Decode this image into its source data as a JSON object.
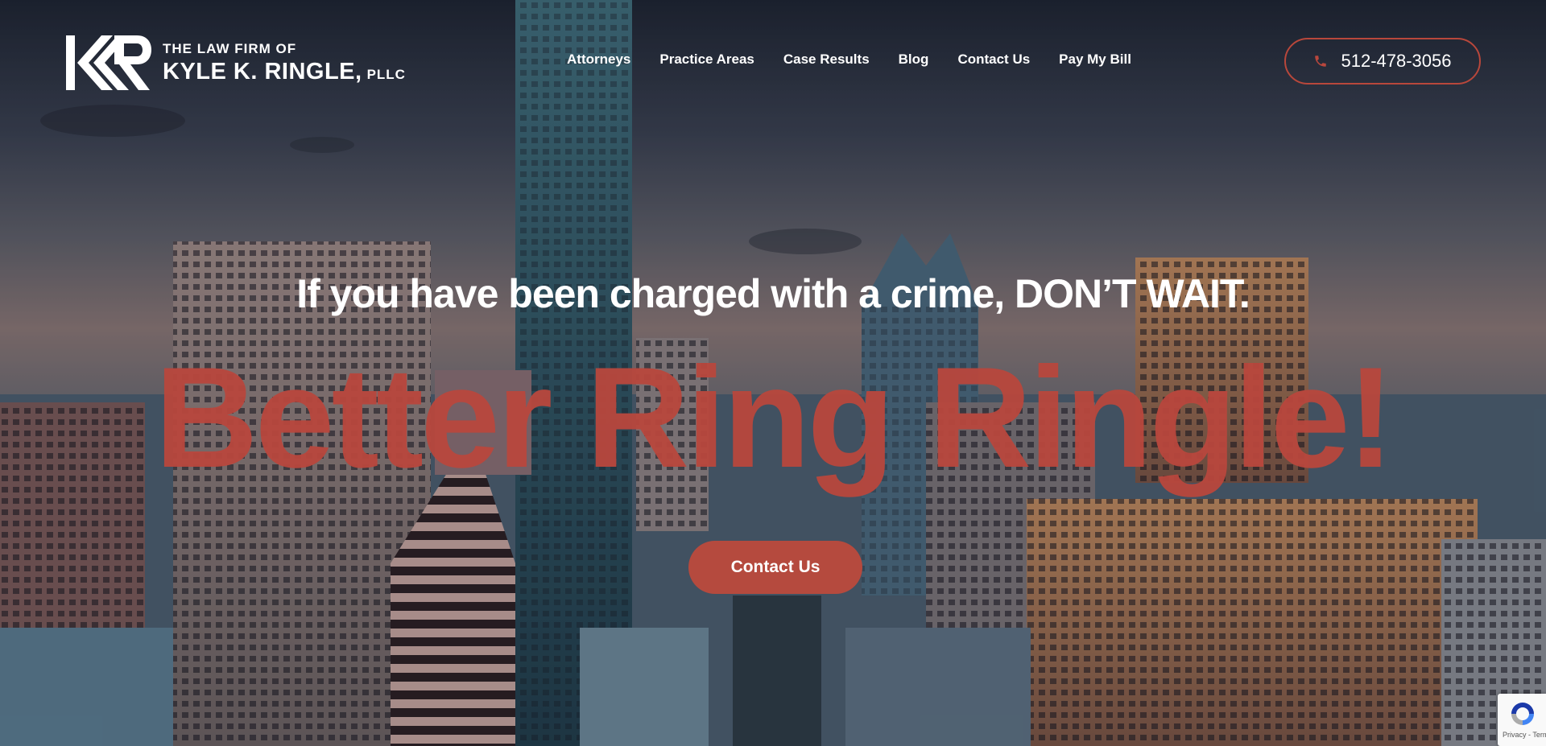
{
  "brand": {
    "logo_line1": "THE LAW FIRM OF",
    "logo_line2": "KYLE K. RINGLE,",
    "logo_suffix": "PLLC",
    "accent_color": "#b9473d"
  },
  "nav": {
    "items": [
      {
        "label": "Attorneys"
      },
      {
        "label": "Practice Areas"
      },
      {
        "label": "Case Results"
      },
      {
        "label": "Blog"
      },
      {
        "label": "Contact Us"
      },
      {
        "label": "Pay My Bill"
      }
    ]
  },
  "phone": {
    "number": "512-478-3056",
    "icon": "phone-icon"
  },
  "hero": {
    "heading": "If you have been charged with a crime, DON’T WAIT.",
    "slogan": "Better Ring Ringle!",
    "cta_label": "Contact Us"
  },
  "recaptcha": {
    "text": "Privacy - Terms"
  }
}
